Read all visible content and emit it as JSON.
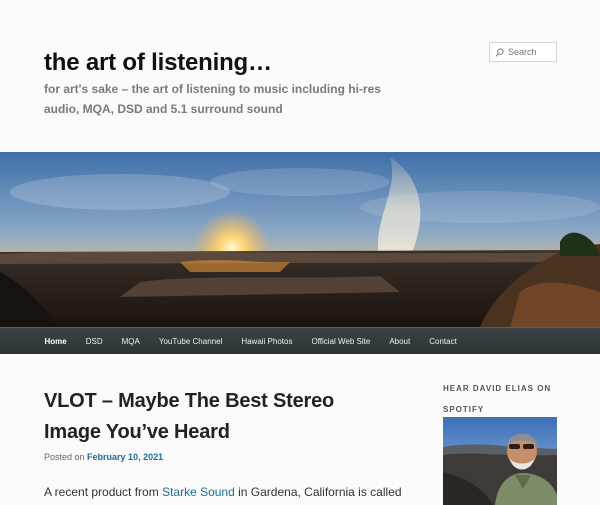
{
  "header": {
    "title": "the art of listening…",
    "description": "for art's sake – the art of listening to music including hi-res audio, MQA, DSD and 5.1 surround sound"
  },
  "search": {
    "placeholder": "Search"
  },
  "nav": {
    "items": [
      "Home",
      "DSD",
      "MQA",
      "YouTube Channel",
      "Hawaii Photos",
      "Official Web Site",
      "About",
      "Contact"
    ]
  },
  "post": {
    "title": "VLOT – Maybe The Best Stereo Image You’ve Heard",
    "posted_on": "Posted on",
    "date": "February 10, 2021",
    "excerpt_pre": "A recent product from ",
    "excerpt_link": "Starke Sound",
    "excerpt_post": " in Gardena, California is called"
  },
  "sidebar": {
    "widget_title": "HEAR DAVID ELIAS ON SPOTIFY"
  },
  "icons": {
    "search": "magnifier-icon"
  },
  "colors": {
    "nav_bg": "#2f3638",
    "link": "#1b6f95",
    "description": "#7a7a7a"
  }
}
